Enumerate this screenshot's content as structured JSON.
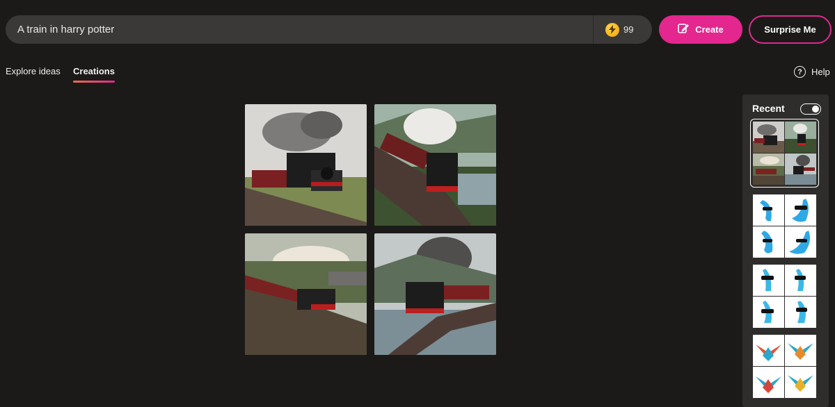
{
  "search": {
    "value": "A train in harry potter",
    "boost_icon": "bolt-icon",
    "boost_count": "99"
  },
  "buttons": {
    "create_label": "Create",
    "create_icon": "create-icon",
    "surprise_label": "Surprise Me"
  },
  "tabs": [
    {
      "label": "Explore ideas",
      "active": false
    },
    {
      "label": "Creations",
      "active": true
    }
  ],
  "help": {
    "label": "Help",
    "icon": "help-icon"
  },
  "sidebar": {
    "title": "Recent",
    "toggle_on": true
  },
  "colors": {
    "background": "#1b1a19",
    "prompt_bar": "#3a3937",
    "accent": "#e3278e",
    "sidebar": "#2e2d2c"
  }
}
